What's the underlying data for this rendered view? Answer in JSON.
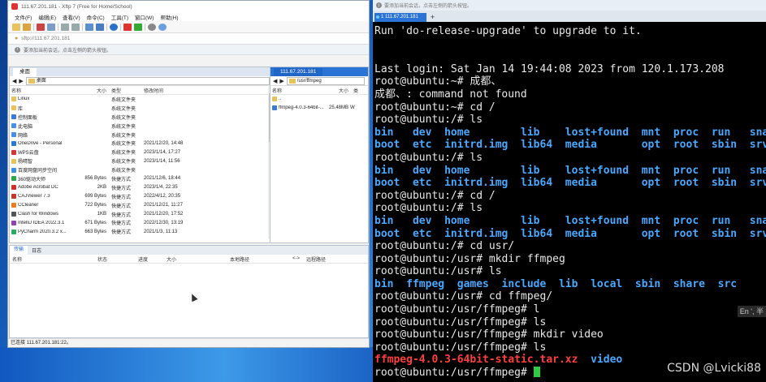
{
  "xftp": {
    "title": "111.67.201.181 - Xftp 7 (Free for Home/School)",
    "menu": [
      "文件(F)",
      "编辑(E)",
      "查看(V)",
      "命令(C)",
      "工具(T)",
      "窗口(W)",
      "帮助(H)"
    ],
    "address": "sftp://111.67.201.181",
    "hint": "要添加当前会话，点击左侧的箭头按钮。",
    "left": {
      "tab": "桌面",
      "path": "桌面",
      "headers": [
        "名称",
        "大小",
        "类型",
        "修改时间"
      ],
      "rows": [
        {
          "name": "Linux",
          "size": "",
          "type": "系统文件夹",
          "date": "",
          "color": "#e8c25a"
        },
        {
          "name": "库",
          "size": "",
          "type": "系统文件夹",
          "date": "",
          "color": "#e8c25a"
        },
        {
          "name": "控制面板",
          "size": "",
          "type": "系统文件夹",
          "date": "",
          "color": "#3a7bd5"
        },
        {
          "name": "此电脑",
          "size": "",
          "type": "系统文件夹",
          "date": "",
          "color": "#4a90e2"
        },
        {
          "name": "网络",
          "size": "",
          "type": "系统文件夹",
          "date": "",
          "color": "#4a90e2"
        },
        {
          "name": "OneDrive - Personal",
          "size": "",
          "type": "系统文件夹",
          "date": "2021/12/20, 14:48",
          "color": "#2a7ad5"
        },
        {
          "name": "WPS云盘",
          "size": "",
          "type": "系统文件夹",
          "date": "2023/1/14, 17:27",
          "color": "#d03838"
        },
        {
          "name": "杨晴智",
          "size": "",
          "type": "系统文件夹",
          "date": "2023/1/14, 11:56",
          "color": "#e8c25a"
        },
        {
          "name": "百度网盘同步空间",
          "size": "",
          "type": "系统文件夹",
          "date": "",
          "color": "#3a8fe0"
        },
        {
          "name": "360驱动大师",
          "size": "856 Bytes",
          "type": "快捷方式",
          "date": "2021/12/6, 18:44",
          "color": "#2ba84a"
        },
        {
          "name": "Adobe Acrobat DC",
          "size": "2KB",
          "type": "快捷方式",
          "date": "2023/1/4, 22:35",
          "color": "#d32f2f"
        },
        {
          "name": "CAJViewer 7.3",
          "size": "699 Bytes",
          "type": "快捷方式",
          "date": "2022/4/12, 20:35",
          "color": "#c0392b"
        },
        {
          "name": "CCleaner",
          "size": "722 Bytes",
          "type": "快捷方式",
          "date": "2021/12/21, 11:27",
          "color": "#e67e22"
        },
        {
          "name": "Clash for Windows",
          "size": "1KB",
          "type": "快捷方式",
          "date": "2021/12/20, 17:52",
          "color": "#555555"
        },
        {
          "name": "IntelliJ IDEA 2022.3.1",
          "size": "671 Bytes",
          "type": "快捷方式",
          "date": "2022/12/30, 13:19",
          "color": "#8e44ad"
        },
        {
          "name": "PyCharm 2020.3.2 x...",
          "size": "663 Bytes",
          "type": "快捷方式",
          "date": "2021/1/3, 11:13",
          "color": "#27ae60"
        }
      ]
    },
    "right": {
      "tab": "111.67.201.181",
      "path": "/usr/ffmpeg",
      "headers": [
        "名称",
        "大小",
        "类"
      ],
      "rows": [
        {
          "name": "..",
          "size": "",
          "type": "",
          "color": "#e8c25a"
        },
        {
          "name": "ffmpeg-4.0.3-64bit-...",
          "size": "25.48MB",
          "type": "W",
          "color": "#3a7bd5"
        }
      ]
    },
    "transfer": {
      "tabs": [
        "传输",
        "日志"
      ],
      "headers": [
        "名称",
        "状态",
        "进度",
        "大小",
        "本地路径",
        "<->",
        "远程路径"
      ]
    },
    "status": "已连接 111.67.201.181:22。"
  },
  "terminal": {
    "title": "要添加当前会话，点击左侧的箭头按钮。",
    "tab": "1 111.67.201.181",
    "lines": [
      [
        {
          "t": "Run 'do-release-upgrade' to upgrade to it."
        }
      ],
      [
        {
          "t": ""
        }
      ],
      [
        {
          "t": ""
        }
      ],
      [
        {
          "t": "Last login: Sat Jan 14 19:44:08 2023 from 120.1.173.208"
        }
      ],
      [
        {
          "t": "root@ubuntu:~# 成都、"
        }
      ],
      [
        {
          "t": "成都、: command not found"
        }
      ],
      [
        {
          "t": "root@ubuntu:~# cd /"
        }
      ],
      [
        {
          "t": "root@ubuntu:/# ls"
        }
      ],
      [
        {
          "t": "bin   dev  home        lib    lost+found  mnt  proc  run   sna",
          "c": "blue"
        }
      ],
      [
        {
          "t": "boot  etc  initrd.img  lib64  media       opt  root  sbin  srv",
          "c": "blue"
        }
      ],
      [
        {
          "t": "root@ubuntu:/# ls"
        }
      ],
      [
        {
          "t": "bin   dev  home        lib    lost+found  mnt  proc  run   sna",
          "c": "blue"
        }
      ],
      [
        {
          "t": "boot  etc  initrd.img  lib64  media       opt  root  sbin  srv",
          "c": "blue"
        }
      ],
      [
        {
          "t": "root@ubuntu:/# cd /"
        }
      ],
      [
        {
          "t": "root@ubuntu:/# ls"
        }
      ],
      [
        {
          "t": "bin   dev  home        lib    lost+found  mnt  proc  run   sna",
          "c": "blue"
        }
      ],
      [
        {
          "t": "boot  etc  initrd.img  lib64  media       opt  root  sbin  srv",
          "c": "blue"
        }
      ],
      [
        {
          "t": "root@ubuntu:/# cd usr/"
        }
      ],
      [
        {
          "t": "root@ubuntu:/usr# mkdir ffmpeg"
        }
      ],
      [
        {
          "t": "root@ubuntu:/usr# ls"
        }
      ],
      [
        {
          "t": "bin  ffmpeg  games  include  lib  local  sbin  share  src",
          "c": "blue"
        }
      ],
      [
        {
          "t": "root@ubuntu:/usr# cd ffmpeg/"
        }
      ],
      [
        {
          "t": "root@ubuntu:/usr/ffmpeg# l"
        }
      ],
      [
        {
          "t": "root@ubuntu:/usr/ffmpeg# ls"
        }
      ],
      [
        {
          "t": "root@ubuntu:/usr/ffmpeg# mkdir video"
        }
      ],
      [
        {
          "t": "root@ubuntu:/usr/ffmpeg# ls"
        }
      ],
      [
        {
          "t": "ffmpeg-4.0.3-64bit-static.tar.xz",
          "c": "red"
        },
        {
          "t": "  "
        },
        {
          "t": "video",
          "c": "blue"
        }
      ],
      [
        {
          "t": "root@ubuntu:/usr/ffmpeg# "
        }
      ]
    ],
    "ime": "En ', 半",
    "watermark": "CSDN @Lvicki88"
  }
}
